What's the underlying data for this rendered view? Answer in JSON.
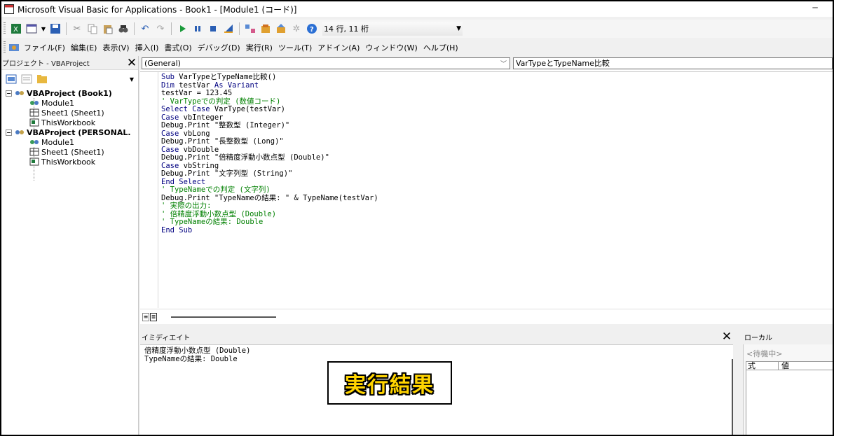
{
  "window": {
    "title": "Microsoft Visual Basic for Applications - Book1 - [Module1 (コード)]",
    "minimize": "─"
  },
  "toolbar": {
    "position": "14 行, 11 桁"
  },
  "menu": [
    "ファイル(F)",
    "編集(E)",
    "表示(V)",
    "挿入(I)",
    "書式(O)",
    "デバッグ(D)",
    "実行(R)",
    "ツール(T)",
    "アドイン(A)",
    "ウィンドウ(W)",
    "ヘルプ(H)"
  ],
  "project": {
    "title": "プロジェクト - VBAProject",
    "close": "✕",
    "tree": [
      {
        "label": "VBAProject (Book1)",
        "level": 0,
        "icon": "vbaproject-icon"
      },
      {
        "label": "Module1",
        "level": 1,
        "icon": "module-icon"
      },
      {
        "label": "Sheet1 (Sheet1)",
        "level": 1,
        "icon": "sheet-icon"
      },
      {
        "label": "ThisWorkbook",
        "level": 1,
        "icon": "workbook-icon"
      },
      {
        "label": "VBAProject (PERSONAL.",
        "level": 0,
        "icon": "vbaproject-icon"
      },
      {
        "label": "Module1",
        "level": 1,
        "icon": "module-icon"
      },
      {
        "label": "Sheet1 (Sheet1)",
        "level": 1,
        "icon": "sheet-icon"
      },
      {
        "label": "ThisWorkbook",
        "level": 1,
        "icon": "workbook-icon"
      }
    ]
  },
  "code": {
    "object_combo": "(General)",
    "proc_combo": "VarTypeとTypeName比較",
    "lines": [
      [
        {
          "t": "Sub ",
          "c": "kw"
        },
        {
          "t": "VarTypeとTypeName比較()",
          "c": "tx"
        }
      ],
      [
        {
          "t": "Dim ",
          "c": "kw"
        },
        {
          "t": "testVar ",
          "c": "tx"
        },
        {
          "t": "As Variant",
          "c": "kw"
        }
      ],
      [
        {
          "t": "testVar = 123.45",
          "c": "tx"
        }
      ],
      [
        {
          "t": "' VarTypeでの判定 (数値コード)",
          "c": "cm"
        }
      ],
      [
        {
          "t": "Select Case ",
          "c": "kw"
        },
        {
          "t": "VarType(testVar)",
          "c": "tx"
        }
      ],
      [
        {
          "t": "Case ",
          "c": "kw"
        },
        {
          "t": "vbInteger",
          "c": "tx"
        }
      ],
      [
        {
          "t": "Debug.Print \"整数型 (Integer)\"",
          "c": "tx"
        }
      ],
      [
        {
          "t": "Case ",
          "c": "kw"
        },
        {
          "t": "vbLong",
          "c": "tx"
        }
      ],
      [
        {
          "t": "Debug.Print \"長整数型 (Long)\"",
          "c": "tx"
        }
      ],
      [
        {
          "t": "Case ",
          "c": "kw"
        },
        {
          "t": "vbDouble",
          "c": "tx"
        }
      ],
      [
        {
          "t": "Debug.Print \"倍精度浮動小数点型 (Double)\"",
          "c": "tx"
        }
      ],
      [
        {
          "t": "Case ",
          "c": "kw"
        },
        {
          "t": "vbString",
          "c": "tx"
        }
      ],
      [
        {
          "t": "Debug.Print \"文字列型 (String)\"",
          "c": "tx"
        }
      ],
      [
        {
          "t": "End Select",
          "c": "kw"
        }
      ],
      [
        {
          "t": "' TypeNameでの判定 (文字列)",
          "c": "cm"
        }
      ],
      [
        {
          "t": "Debug.Print \"TypeNameの結果: \" & TypeName(testVar)",
          "c": "tx"
        }
      ],
      [
        {
          "t": "' 実際の出力:",
          "c": "cm"
        }
      ],
      [
        {
          "t": "' 倍精度浮動小数点型 (Double)",
          "c": "cm"
        }
      ],
      [
        {
          "t": "' TypeNameの結果: Double",
          "c": "cm"
        }
      ],
      [
        {
          "t": "End Sub",
          "c": "kw"
        }
      ]
    ]
  },
  "immediate": {
    "title": "イミディエイト",
    "close": "✕",
    "lines": [
      "倍精度浮動小数点型 (Double)",
      "TypeNameの結果: Double"
    ]
  },
  "result_label": "実行結果",
  "locals": {
    "title": "ローカル",
    "status": "<待機中>",
    "columns": [
      "式",
      "値"
    ]
  },
  "colors": {
    "keyword": "#000080",
    "comment": "#008000",
    "result_fill": "#ffd400"
  }
}
